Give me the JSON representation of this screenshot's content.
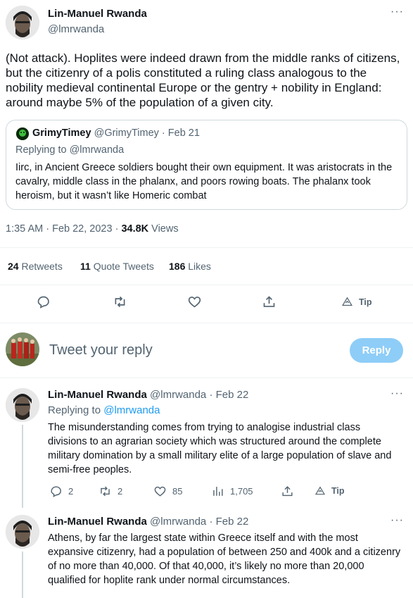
{
  "main_tweet": {
    "author_name": "Lin-Manuel Rwanda",
    "author_handle": "@lmrwanda",
    "text": "(Not attack). Hoplites were indeed drawn from the middle ranks of citizens, but the citizenry of a polis constituted a ruling class analogous to the nobility medieval continental Europe or the gentry + nobility in England: around maybe 5% of the population of a given city.",
    "more_icon": "more-dots-icon",
    "time": "1:35 AM · Feb 22, 2023 · ",
    "views_count": "34.8K",
    "views_label": " Views",
    "retweets_count": "24",
    "retweets_label": " Retweets",
    "quotes_count": "11",
    "quotes_label": " Quote Tweets",
    "likes_count": "186",
    "likes_label": " Likes",
    "tip_label": "Tip"
  },
  "quote_tweet": {
    "author_name": "GrimyTimey",
    "author_handle": "@GrimyTimey",
    "date": " · Feb 21",
    "replying_prefix": "Replying to ",
    "replying_handle": "@lmrwanda",
    "text": "Iirc, in Ancient Greece soldiers bought their own equipment. It was aristocrats in the cavalry, middle class in the phalanx, and poors rowing boats. The phalanx took heroism, but it wasn’t like Homeric combat"
  },
  "composer": {
    "placeholder": "Tweet your reply",
    "reply_button": "Reply"
  },
  "replies": [
    {
      "author_name": "Lin-Manuel Rwanda",
      "author_handle": "@lmrwanda",
      "date": " · Feb 22",
      "replying_prefix": "Replying to ",
      "replying_handle": "@lmrwanda",
      "text": "The misunderstanding comes from trying to analogise industrial class divisions to an agrarian society which was structured around the complete military domination by a small military elite of a large population of slave and semi-free peoples.",
      "reply_count": "2",
      "retweet_count": "2",
      "like_count": "85",
      "views_count": "1,705",
      "tip_label": "Tip"
    },
    {
      "author_name": "Lin-Manuel Rwanda",
      "author_handle": "@lmrwanda",
      "date": " · Feb 22",
      "text": "Athens, by far the largest state within Greece itself and with the most expansive citizenry, had a population of between 250 and 400k and a citizenry of no more than 40,000. Of that 40,000, it’s likely no more than 20,000 qualified for hoplite rank under normal circumstances."
    }
  ],
  "colors": {
    "accent": "#1d9bf0",
    "reply_button_disabled": "#8ecdf7",
    "muted_text": "#536471",
    "border": "#cfd9de"
  }
}
